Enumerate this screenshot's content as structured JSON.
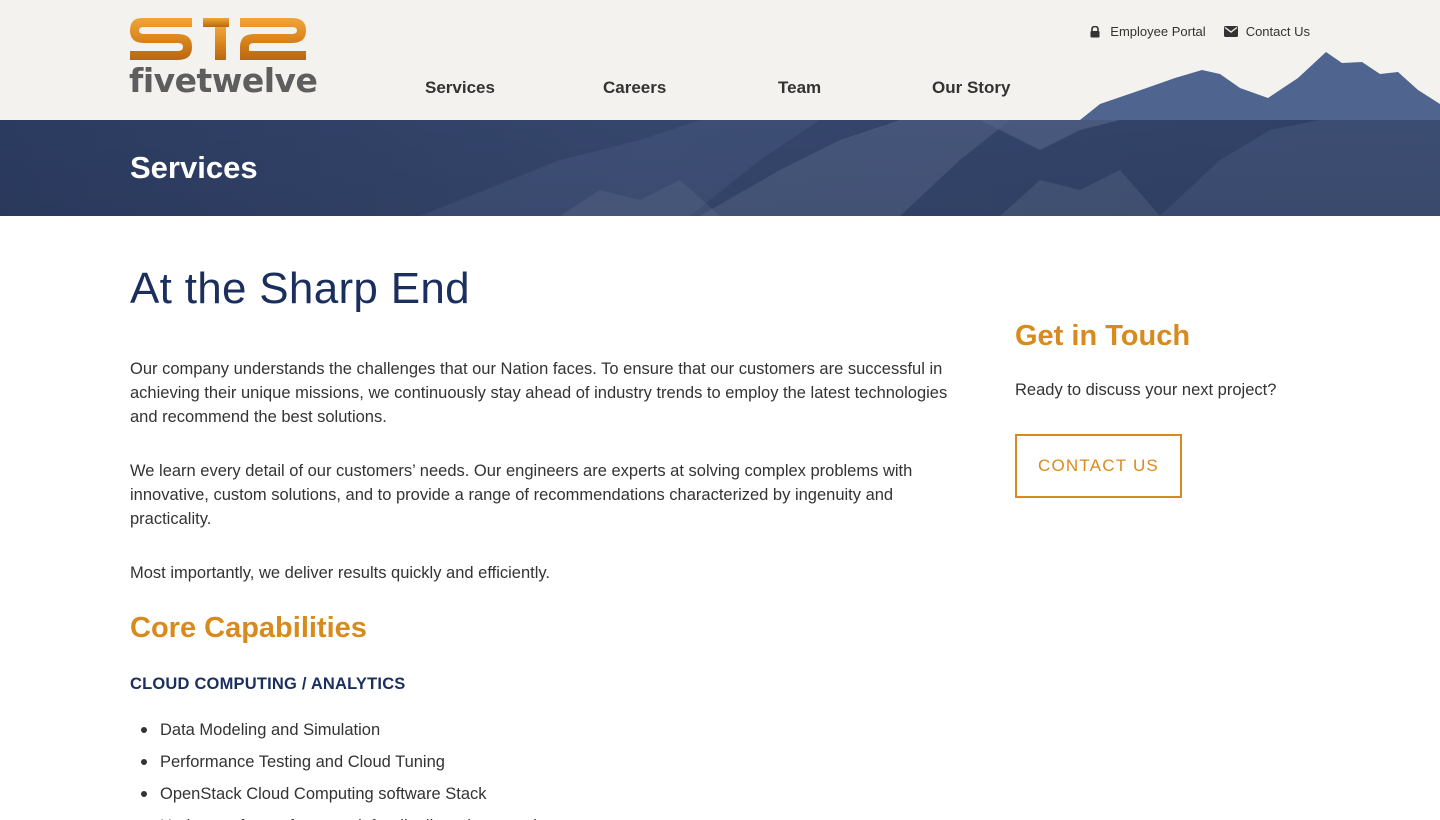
{
  "brand": {
    "name": "fivetwelve",
    "mark_icon": "512-logo-mark",
    "colors": {
      "orange": "#d98a1d",
      "navy": "#1b2f5e",
      "gray": "#5e5e5e"
    }
  },
  "utility": {
    "employee_portal": {
      "icon": "lock-icon",
      "label": "Employee Portal"
    },
    "contact_us": {
      "icon": "envelope-icon",
      "label": "Contact Us"
    }
  },
  "nav": {
    "items": [
      {
        "label": "Services"
      },
      {
        "label": "Careers"
      },
      {
        "label": "Team"
      },
      {
        "label": "Our Story"
      }
    ]
  },
  "banner": {
    "title": "Services"
  },
  "main": {
    "heading": "At the Sharp End",
    "paragraphs": [
      "Our company understands the challenges that our Nation faces. To ensure that our customers are successful in achieving their unique missions, we continuously stay ahead of industry trends to employ the latest technologies and recommend the best solutions.",
      "We learn every detail of our customers’ needs. Our engineers are experts at solving complex problems with innovative, custom solutions, and to provide a range of recommendations characterized by ingenuity and practicality.",
      "Most importantly, we deliver results quickly and efficiently."
    ],
    "capabilities": {
      "heading": "Core Capabilities",
      "subheading": "CLOUD COMPUTING / ANALYTICS",
      "items": [
        "Data Modeling and Simulation",
        "Performance Testing and Cloud Tuning",
        "OpenStack Cloud Computing software Stack",
        "Hadoop software framework for distributed processing"
      ]
    }
  },
  "sidebar": {
    "heading": "Get in Touch",
    "text": "Ready to discuss your next project?",
    "button_label": "CONTACT US"
  }
}
